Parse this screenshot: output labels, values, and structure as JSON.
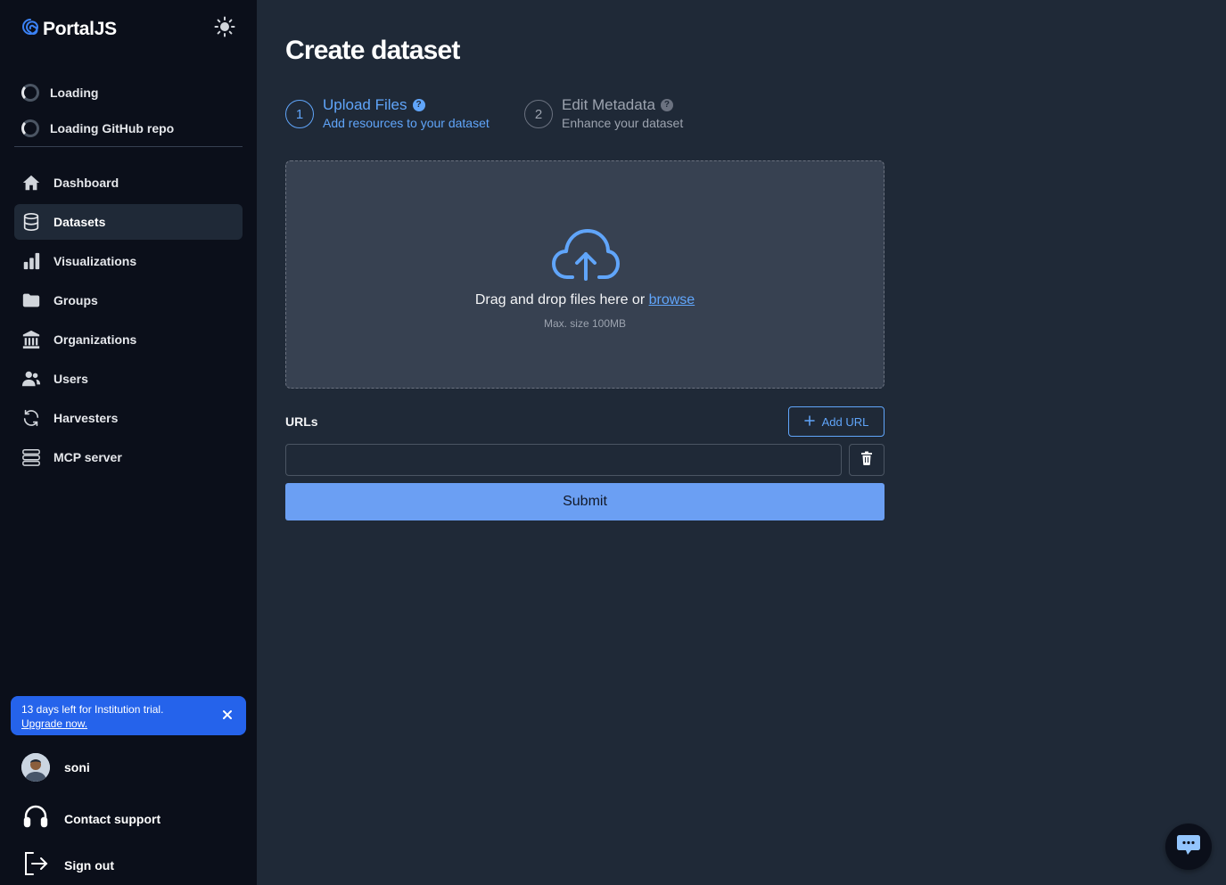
{
  "brand": {
    "name": "PortalJS",
    "logo_icon": "spiral-logo-icon",
    "theme_icon": "sun-icon"
  },
  "sidebar": {
    "loading_items": [
      {
        "label": "Loading"
      },
      {
        "label": "Loading GitHub repo"
      }
    ],
    "nav": [
      {
        "label": "Dashboard",
        "icon": "home-icon",
        "active": false
      },
      {
        "label": "Datasets",
        "icon": "database-icon",
        "active": true
      },
      {
        "label": "Visualizations",
        "icon": "bar-chart-icon",
        "active": false
      },
      {
        "label": "Groups",
        "icon": "folder-icon",
        "active": false
      },
      {
        "label": "Organizations",
        "icon": "building-icon",
        "active": false
      },
      {
        "label": "Users",
        "icon": "users-icon",
        "active": false
      },
      {
        "label": "Harvesters",
        "icon": "refresh-icon",
        "active": false
      },
      {
        "label": "MCP server",
        "icon": "server-icon",
        "active": false
      }
    ],
    "trial": {
      "text": "13 days left for Institution trial.",
      "link": "Upgrade now."
    },
    "user": {
      "name": "soni"
    },
    "support": {
      "label": "Contact support"
    },
    "signout": {
      "label": "Sign out"
    }
  },
  "main": {
    "title": "Create dataset",
    "steps": [
      {
        "number": "1",
        "title": "Upload Files",
        "subtitle": "Add resources to your dataset",
        "state": "active"
      },
      {
        "number": "2",
        "title": "Edit Metadata",
        "subtitle": "Enhance your dataset",
        "state": "inactive"
      }
    ],
    "dropzone": {
      "text": "Drag and drop files here or ",
      "link": "browse",
      "hint": "Max. size 100MB"
    },
    "urls": {
      "label": "URLs",
      "add_label": "Add URL",
      "input_value": "",
      "input_placeholder": ""
    },
    "submit_label": "Submit"
  },
  "colors": {
    "accent": "#60a5fa",
    "sidebar_bg": "#0b0f1a",
    "main_bg": "#1f2937",
    "banner": "#2563eb",
    "submit": "#6b9ff3"
  }
}
